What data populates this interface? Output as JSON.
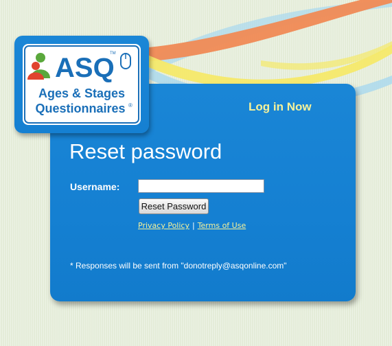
{
  "colors": {
    "page_background": "#e4ecd8",
    "panel_blue": "#1580d2",
    "link_yellow": "#f6f29a",
    "swoosh_orange": "#f08a55",
    "swoosh_yellow": "#f5e96a",
    "swoosh_blue": "#a8d8ef",
    "logo_red": "#e0442e",
    "logo_green": "#5aa83c",
    "logo_blue": "#1a6fb8"
  },
  "logo": {
    "abbreviation": "ASQ",
    "tm_mark": "TM",
    "line1": "Ages & Stages",
    "line2": "Questionnaires",
    "registered_mark": "®"
  },
  "header": {
    "login_link": "Log in Now"
  },
  "form": {
    "title": "Reset password",
    "username_label": "Username:",
    "username_value": "",
    "submit_label": "Reset Password"
  },
  "links": {
    "privacy": "Privacy Policy",
    "separator": "|",
    "terms": "Terms of Use"
  },
  "footnote": "* Responses will be sent from \"donotreply@asqonline.com\""
}
